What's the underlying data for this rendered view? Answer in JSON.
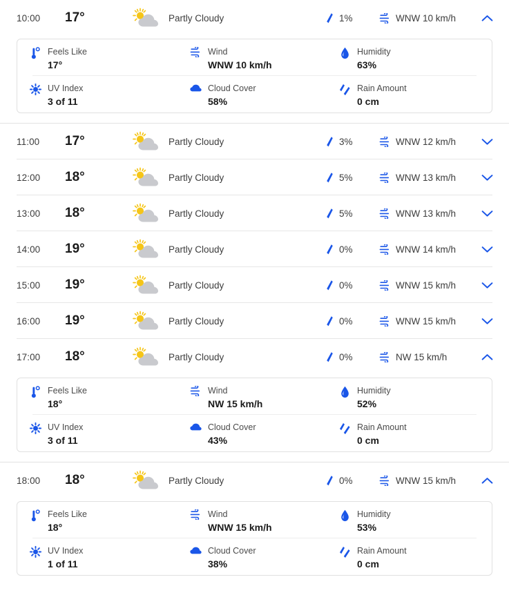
{
  "colors": {
    "accent_blue": "#1a56e8",
    "sun_yellow": "#f5c518",
    "cloud_gray": "#c9cace",
    "text_primary": "#1a1a1a",
    "text_secondary": "#3c3c3c",
    "divider": "#e6e6e6",
    "card_border": "#e0e0e0"
  },
  "detail_labels": {
    "feels_like": "Feels Like",
    "wind": "Wind",
    "humidity": "Humidity",
    "uv_index": "UV Index",
    "cloud_cover": "Cloud Cover",
    "rain_amount": "Rain Amount"
  },
  "icons": {
    "condition": "sun-behind-cloud-icon",
    "precip": "raindrop-icon",
    "wind": "wind-icon",
    "expand": "chevron-down-icon",
    "collapse": "chevron-up-icon",
    "feels_like": "thermometer-icon",
    "wind_detail": "wind-icon",
    "humidity": "water-drop-icon",
    "uv_index": "sun-burst-icon",
    "cloud_cover": "cloud-icon",
    "rain_amount": "double-raindrop-icon"
  },
  "hours": [
    {
      "time": "10:00",
      "temp": "17°",
      "condition": "Partly Cloudy",
      "precip": "1%",
      "wind": "WNW 10 km/h",
      "expanded": true,
      "details": {
        "feels_like": "17°",
        "wind": "WNW 10 km/h",
        "humidity": "63%",
        "uv_index": "3 of 11",
        "cloud_cover": "58%",
        "rain_amount": "0 cm"
      }
    },
    {
      "time": "11:00",
      "temp": "17°",
      "condition": "Partly Cloudy",
      "precip": "3%",
      "wind": "WNW 12 km/h",
      "expanded": false
    },
    {
      "time": "12:00",
      "temp": "18°",
      "condition": "Partly Cloudy",
      "precip": "5%",
      "wind": "WNW 13 km/h",
      "expanded": false
    },
    {
      "time": "13:00",
      "temp": "18°",
      "condition": "Partly Cloudy",
      "precip": "5%",
      "wind": "WNW 13 km/h",
      "expanded": false
    },
    {
      "time": "14:00",
      "temp": "19°",
      "condition": "Partly Cloudy",
      "precip": "0%",
      "wind": "WNW 14 km/h",
      "expanded": false
    },
    {
      "time": "15:00",
      "temp": "19°",
      "condition": "Partly Cloudy",
      "precip": "0%",
      "wind": "WNW 15 km/h",
      "expanded": false
    },
    {
      "time": "16:00",
      "temp": "19°",
      "condition": "Partly Cloudy",
      "precip": "0%",
      "wind": "WNW 15 km/h",
      "expanded": false
    },
    {
      "time": "17:00",
      "temp": "18°",
      "condition": "Partly Cloudy",
      "precip": "0%",
      "wind": "NW 15 km/h",
      "expanded": true,
      "details": {
        "feels_like": "18°",
        "wind": "NW 15 km/h",
        "humidity": "52%",
        "uv_index": "3 of 11",
        "cloud_cover": "43%",
        "rain_amount": "0 cm"
      }
    },
    {
      "time": "18:00",
      "temp": "18°",
      "condition": "Partly Cloudy",
      "precip": "0%",
      "wind": "WNW 15 km/h",
      "expanded": true,
      "details": {
        "feels_like": "18°",
        "wind": "WNW 15 km/h",
        "humidity": "53%",
        "uv_index": "1 of 11",
        "cloud_cover": "38%",
        "rain_amount": "0 cm"
      }
    }
  ]
}
